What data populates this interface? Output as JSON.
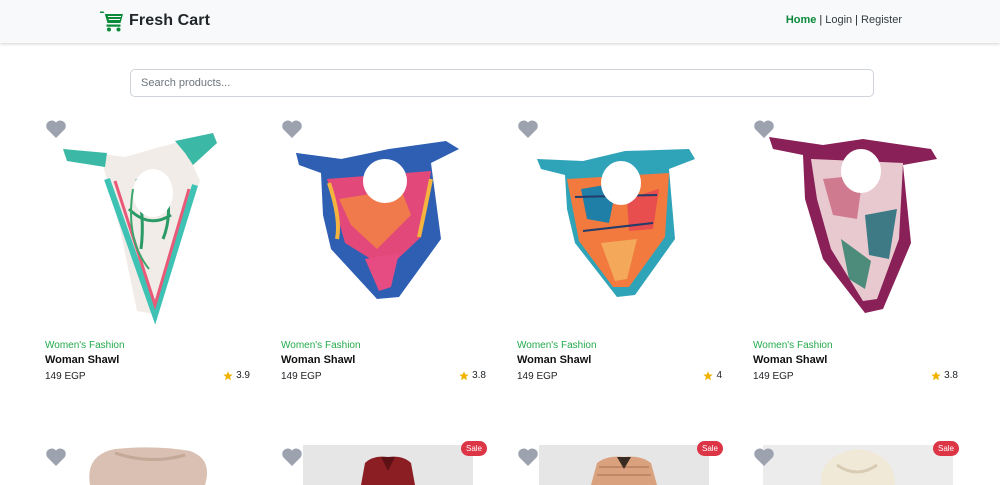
{
  "brand": {
    "name": "Fresh Cart",
    "icon": "cart-icon",
    "color": "#0a8a3a"
  },
  "nav": {
    "links": [
      {
        "label": "Home",
        "active": true
      },
      {
        "label": "Login",
        "active": false
      },
      {
        "label": "Register",
        "active": false
      }
    ],
    "separator": "|"
  },
  "search": {
    "placeholder": "Search products...",
    "value": ""
  },
  "colors": {
    "accent": "#0a8a3a",
    "category": "#22a94a",
    "star": "#f0b400",
    "heart": "#9ca3af",
    "sale": "#dc3545"
  },
  "products": [
    {
      "category": "Women's Fashion",
      "title": "Woman Shawl",
      "price": "149 EGP",
      "rating": "3.9",
      "image": "scarf-white-green"
    },
    {
      "category": "Women's Fashion",
      "title": "Woman Shawl",
      "price": "149 EGP",
      "rating": "3.8",
      "image": "scarf-pink-blue"
    },
    {
      "category": "Women's Fashion",
      "title": "Woman Shawl",
      "price": "149 EGP",
      "rating": "4",
      "image": "scarf-orange-teal"
    },
    {
      "category": "Women's Fashion",
      "title": "Woman Shawl",
      "price": "149 EGP",
      "rating": "3.8",
      "image": "scarf-burgundy-pink"
    }
  ],
  "products_row2": [
    {
      "image": "hooded-beige",
      "sale": ""
    },
    {
      "image": "coat-burgundy",
      "sale": "Sale"
    },
    {
      "image": "coat-tan",
      "sale": "Sale"
    },
    {
      "image": "hoodie-cream",
      "sale": "Sale"
    }
  ]
}
